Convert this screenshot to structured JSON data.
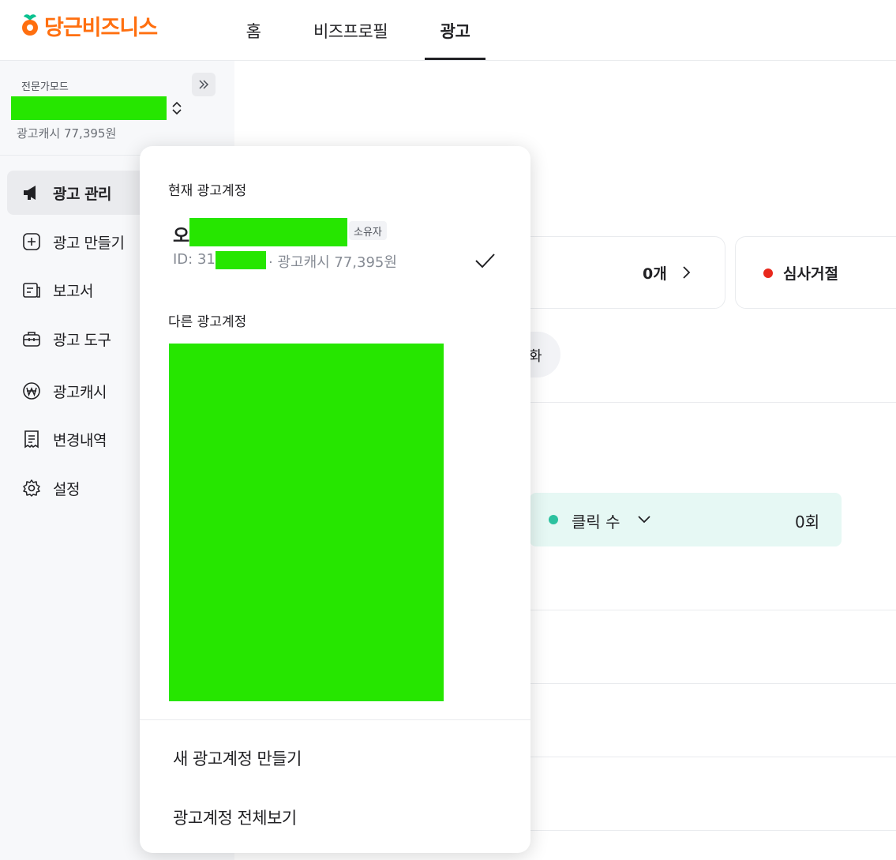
{
  "header": {
    "logo_text": "당근비즈니스",
    "brand_color": "#ff6f0f",
    "tabs": [
      {
        "label": "홈",
        "active": false
      },
      {
        "label": "비즈프로필",
        "active": false
      },
      {
        "label": "광고",
        "active": true
      }
    ]
  },
  "sidebar": {
    "mode_label": "전문가모드",
    "account_name": "",
    "cash_label": "광고캐시 77,395원",
    "items": [
      {
        "label": "광고 관리",
        "icon": "megaphone-icon",
        "active": true
      },
      {
        "label": "광고 만들기",
        "icon": "plus-square-icon",
        "active": false
      },
      {
        "label": "보고서",
        "icon": "report-icon",
        "active": false
      },
      {
        "label": "광고 도구",
        "icon": "briefcase-icon",
        "active": false
      },
      {
        "label": "광고캐시",
        "icon": "won-coin-icon",
        "active": false
      },
      {
        "label": "변경내역",
        "icon": "receipt-icon",
        "active": false
      },
      {
        "label": "설정",
        "icon": "gear-icon",
        "active": false
      }
    ]
  },
  "main": {
    "card_count": "0개",
    "reject_label": "심사거절",
    "reject_color": "#e8281c",
    "pill_text": "화",
    "click_label": "클릭 수",
    "click_value": "0회",
    "click_color": "#2cc19f"
  },
  "account_dropdown": {
    "current_title": "현재 광고계정",
    "current_initial": "오",
    "owner_badge": "소유자",
    "id_prefix": "ID: 31",
    "cash_text": "· 광고캐시 77,395원",
    "other_title": "다른 광고계정",
    "actions": [
      "새 광고계정 만들기",
      "광고계정 전체보기"
    ]
  },
  "redaction_color": "#26e600"
}
